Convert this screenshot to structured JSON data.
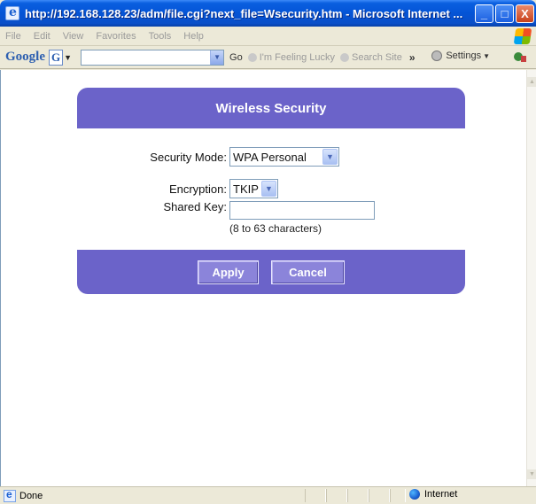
{
  "window": {
    "title": "http://192.168.128.23/adm/file.cgi?next_file=Wsecurity.htm - Microsoft Internet ...",
    "minimize": "_",
    "maximize": "□",
    "close": "X"
  },
  "menu": [
    "File",
    "Edit",
    "View",
    "Favorites",
    "Tools",
    "Help"
  ],
  "google_toolbar": {
    "logo": "Google",
    "g_button": "G",
    "search_value": "",
    "go": "Go",
    "feeling_lucky": "I'm Feeling Lucky",
    "search_site": "Search Site",
    "more": "»",
    "settings": "Settings"
  },
  "page": {
    "header": "Wireless Security",
    "security_mode_label": "Security Mode:",
    "security_mode_value": "WPA Personal",
    "encryption_label": "Encryption:",
    "encryption_value": "TKIP",
    "shared_key_label": "Shared Key:",
    "shared_key_value": "",
    "shared_key_hint": "(8 to 63 characters)",
    "apply": "Apply",
    "cancel": "Cancel"
  },
  "status": {
    "text": "Done",
    "zone": "Internet"
  },
  "colors": {
    "panel": "#6b63c9",
    "titlebar": "#0454d6"
  }
}
